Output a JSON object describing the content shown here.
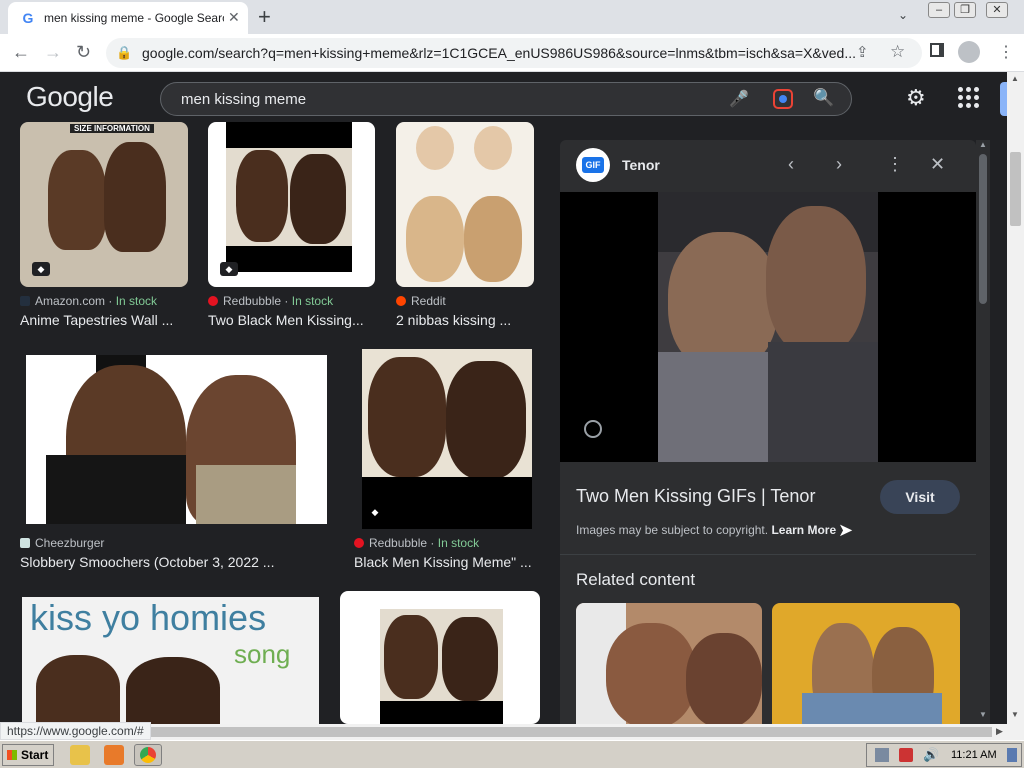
{
  "browser": {
    "tab_title": "men kissing meme - Google Search",
    "url": "google.com/search?q=men+kissing+meme&rlz=1C1GCEA_enUS986US986&source=lnms&tbm=isch&sa=X&ved...",
    "status_url": "https://www.google.com/#"
  },
  "google": {
    "logo": "Google",
    "query": "men kissing meme"
  },
  "results": [
    {
      "source": "Amazon.com",
      "stock": "In stock",
      "title": "Anime Tapestries Wall ...",
      "overlay": "SIZE INFORMATION",
      "source_color": "#232f3e"
    },
    {
      "source": "Redbubble",
      "stock": "In stock",
      "title": "Two Black Men Kissing...",
      "source_color": "#e41321"
    },
    {
      "source": "Reddit",
      "stock": "",
      "title": "2 nibbas kissing ...",
      "source_color": "#ff4500"
    },
    {
      "source": "Cheezburger",
      "stock": "",
      "title": "Slobbery Smoochers (October 3, 2022 ...",
      "source_color": "#cfe3e1"
    },
    {
      "source": "Redbubble",
      "stock": "In stock",
      "title": "Black Men Kissing Meme\" ...",
      "source_color": "#e41321"
    },
    {
      "overlay_line1": "kiss yo homies",
      "overlay_line2": "song"
    }
  ],
  "panel": {
    "site": "Tenor",
    "title": "Two Men Kissing GIFs | Tenor",
    "visit": "Visit",
    "copyright": "Images may be subject to copyright.",
    "learn_more": "Learn More",
    "related": "Related content"
  },
  "taskbar": {
    "start": "Start",
    "time": "11:21 AM"
  },
  "colors": {
    "page_bg": "#202124",
    "panel_bg": "#2d2e30",
    "in_stock": "#81c995",
    "visit_bg": "#394457"
  }
}
